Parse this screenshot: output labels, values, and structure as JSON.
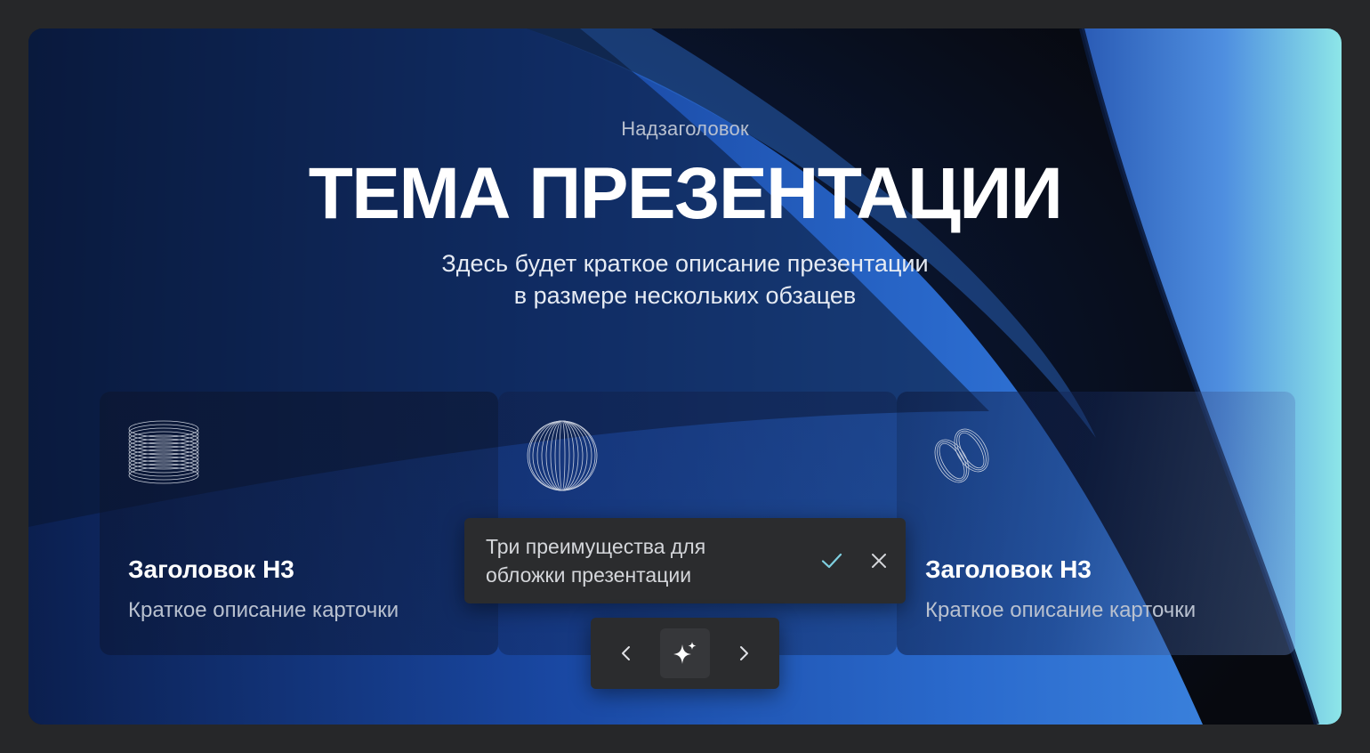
{
  "slide": {
    "overline": "Надзаголовок",
    "title": "ТЕМА ПРЕЗЕНТАЦИИ",
    "description_lines": [
      "Здесь будет краткое описание презентации",
      "в размере нескольких обзацев"
    ]
  },
  "cards": [
    {
      "icon": "stacked-rings-icon",
      "title": "Заголовок Н3",
      "text": "Краткое описание карточки"
    },
    {
      "icon": "wireframe-sphere-icon",
      "title": "",
      "text": ""
    },
    {
      "icon": "interlocked-rings-icon",
      "title": "Заголовок Н3",
      "text": "Краткое описание карточки"
    }
  ],
  "prompt": {
    "lines": [
      "Три преимущества для",
      "обложки презентации"
    ],
    "confirm_icon": "check-icon",
    "dismiss_icon": "close-icon"
  },
  "navigation": {
    "prev_icon": "chevron-left-icon",
    "ai_icon": "sparkle-icon",
    "next_icon": "chevron-right-icon"
  },
  "colors": {
    "page_background": "#262729",
    "slide_background": "#07090f",
    "accent_blue": "#2c6fd6",
    "accent_cyan": "#7fe3e6",
    "toolbar_background": "#2b2c2e",
    "confirm_color": "#7fd0e0"
  }
}
